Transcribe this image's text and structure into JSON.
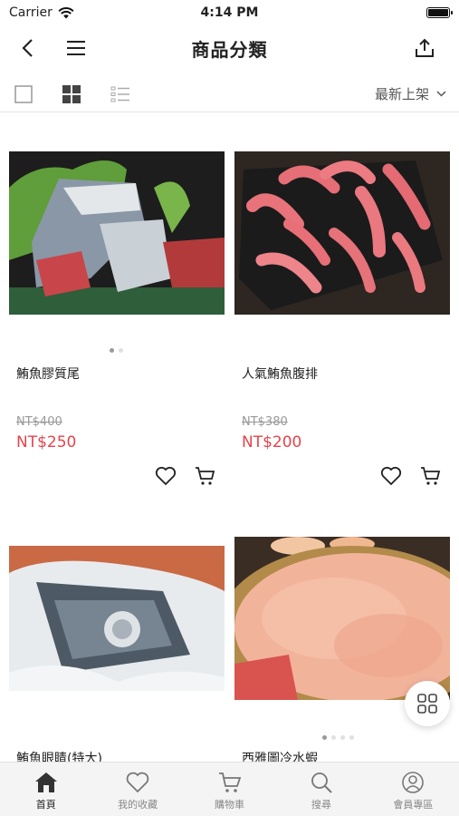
{
  "status": {
    "carrier": "Carrier",
    "time": "4:14 PM"
  },
  "nav": {
    "title": "商品分類"
  },
  "toolbar": {
    "sort_label": "最新上架"
  },
  "products": [
    {
      "name": "鮪魚膠質尾",
      "old_price": "NT$400",
      "price": "NT$250"
    },
    {
      "name": "人氣鮪魚腹排",
      "old_price": "NT$380",
      "price": "NT$200"
    },
    {
      "name": "鮪魚眼睛(特大)"
    },
    {
      "name": "西雅圖冷水蝦"
    }
  ],
  "tabs": [
    {
      "label": "首頁",
      "icon": "home-icon"
    },
    {
      "label": "我的收藏",
      "icon": "heart-icon"
    },
    {
      "label": "購物車",
      "icon": "cart-icon"
    },
    {
      "label": "搜尋",
      "icon": "search-icon"
    },
    {
      "label": "會員專區",
      "icon": "user-icon"
    }
  ],
  "colors": {
    "price_red": "#e8434b",
    "muted": "#999999",
    "tab_bg": "#f4f4f4"
  }
}
